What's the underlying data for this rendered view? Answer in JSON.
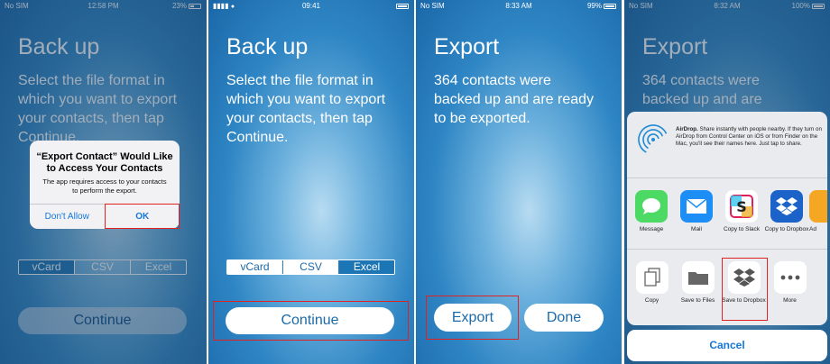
{
  "screen1": {
    "status": {
      "carrier": "No SIM",
      "time": "12:58 PM",
      "battery": "23%"
    },
    "title": "Back up",
    "description": "Select the file format in which you want to export your contacts, then tap Continue.",
    "segments": [
      "vCard",
      "CSV",
      "Excel"
    ],
    "selected_segment": "vCard",
    "continue_label": "Continue",
    "alert": {
      "title": "“Export Contact” Would Like to Access Your Contacts",
      "message": "The app requires access to your contacts to perform the export.",
      "deny": "Don't Allow",
      "ok": "OK"
    }
  },
  "screen2": {
    "status": {
      "time": "09:41"
    },
    "title": "Back up",
    "description": "Select the file format in which you want to export your contacts, then tap Continue.",
    "segments": [
      "vCard",
      "CSV",
      "Excel"
    ],
    "selected_segment": "Excel",
    "continue_label": "Continue"
  },
  "screen3": {
    "status": {
      "carrier": "No SIM",
      "time": "8:33 AM",
      "battery": "99%"
    },
    "title": "Export",
    "description": "364 contacts were backed up and are ready to be exported.",
    "export_label": "Export",
    "done_label": "Done"
  },
  "screen4": {
    "status": {
      "carrier": "No SIM",
      "time": "8:32 AM",
      "battery": "100%"
    },
    "title": "Export",
    "description": "364 contacts were backed up and are",
    "airdrop": {
      "name": "AirDrop.",
      "text": "Share instantly with people nearby. If they turn on AirDrop from Control Center on iOS or from Finder on the Mac, you'll see their names here. Just tap to share."
    },
    "apps": [
      "Message",
      "Mail",
      "Copy to Slack",
      "Copy to Dropbox",
      "Ad"
    ],
    "actions": [
      "Copy",
      "Save to Files",
      "Save to Dropbox",
      "More"
    ],
    "cancel_label": "Cancel"
  },
  "colors": {
    "highlight": "#e02222",
    "ios_blue": "#1478d8",
    "bg_blue": "#2f86c4"
  }
}
